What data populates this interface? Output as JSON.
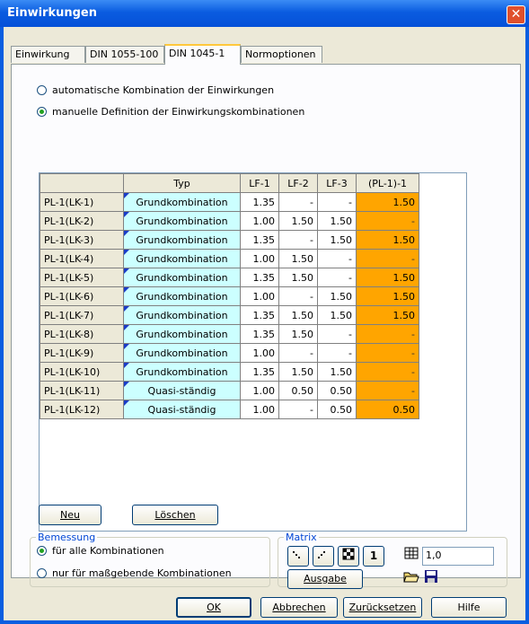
{
  "window": {
    "title": "Einwirkungen",
    "close_icon": "close-icon"
  },
  "tabs": [
    {
      "label": "Einwirkung"
    },
    {
      "label": "DIN 1055-100"
    },
    {
      "label": "DIN 1045-1",
      "active": true
    },
    {
      "label": "Normoptionen"
    }
  ],
  "mode": {
    "auto_label": "automatische Kombination der Einwirkungen",
    "manual_label": "manuelle Definition der Einwirkungskombinationen",
    "selected": "manual"
  },
  "grid": {
    "headers": [
      "",
      "Typ",
      "LF-1",
      "LF-2",
      "LF-3",
      "(PL-1)-1"
    ],
    "rows": [
      {
        "name": "PL-1(LK-1)",
        "typ": "Grundkombination",
        "lf1": "1.35",
        "lf2": "-",
        "lf3": "-",
        "res": "1.50"
      },
      {
        "name": "PL-1(LK-2)",
        "typ": "Grundkombination",
        "lf1": "1.00",
        "lf2": "1.50",
        "lf3": "1.50",
        "res": "-"
      },
      {
        "name": "PL-1(LK-3)",
        "typ": "Grundkombination",
        "lf1": "1.35",
        "lf2": "-",
        "lf3": "1.50",
        "res": "1.50"
      },
      {
        "name": "PL-1(LK-4)",
        "typ": "Grundkombination",
        "lf1": "1.00",
        "lf2": "1.50",
        "lf3": "-",
        "res": "-"
      },
      {
        "name": "PL-1(LK-5)",
        "typ": "Grundkombination",
        "lf1": "1.35",
        "lf2": "1.50",
        "lf3": "-",
        "res": "1.50"
      },
      {
        "name": "PL-1(LK-6)",
        "typ": "Grundkombination",
        "lf1": "1.00",
        "lf2": "-",
        "lf3": "1.50",
        "res": "1.50"
      },
      {
        "name": "PL-1(LK-7)",
        "typ": "Grundkombination",
        "lf1": "1.35",
        "lf2": "1.50",
        "lf3": "1.50",
        "res": "1.50"
      },
      {
        "name": "PL-1(LK-8)",
        "typ": "Grundkombination",
        "lf1": "1.35",
        "lf2": "1.50",
        "lf3": "-",
        "res": "-"
      },
      {
        "name": "PL-1(LK-9)",
        "typ": "Grundkombination",
        "lf1": "1.00",
        "lf2": "-",
        "lf3": "-",
        "res": "-"
      },
      {
        "name": "PL-1(LK-10)",
        "typ": "Grundkombination",
        "lf1": "1.35",
        "lf2": "1.50",
        "lf3": "1.50",
        "res": "-"
      },
      {
        "name": "PL-1(LK-11)",
        "typ": "Quasi-ständig",
        "lf1": "1.00",
        "lf2": "0.50",
        "lf3": "0.50",
        "res": "-"
      },
      {
        "name": "PL-1(LK-12)",
        "typ": "Quasi-ständig",
        "lf1": "1.00",
        "lf2": "-",
        "lf3": "0.50",
        "res": "0.50"
      }
    ]
  },
  "buttons": {
    "neu": "Neu",
    "loeschen": "Löschen"
  },
  "bemessung": {
    "title": "Bemessung",
    "all_label": "für alle Kombinationen",
    "relevant_label": "nur für maßgebende Kombinationen",
    "selected": "all"
  },
  "matrix": {
    "title": "Matrix",
    "one_label": "1",
    "factor_value": "1,0",
    "ausgabe_label": "Ausgabe",
    "icons": [
      "lower-triangle-icon",
      "upper-triangle-icon",
      "checker-matrix-icon",
      "grid-table-icon",
      "open-folder-icon",
      "save-disk-icon"
    ]
  },
  "footer": {
    "ok": "OK",
    "abbrechen": "Abbrechen",
    "zuruecksetzen": "Zurücksetzen",
    "hilfe": "Hilfe"
  },
  "colors": {
    "title_bar": "#0a5ce0",
    "typ_cell": "#ccffff",
    "result_cell": "#ffa500",
    "dialog_bg": "#ece9d8"
  }
}
